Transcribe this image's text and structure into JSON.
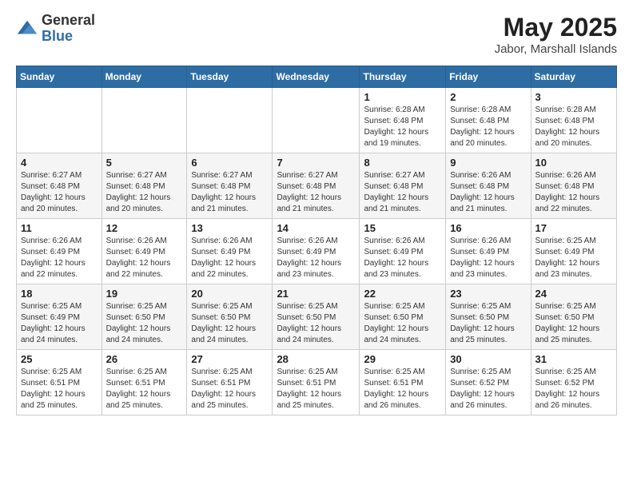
{
  "logo": {
    "general": "General",
    "blue": "Blue"
  },
  "title": "May 2025",
  "location": "Jabor, Marshall Islands",
  "days_of_week": [
    "Sunday",
    "Monday",
    "Tuesday",
    "Wednesday",
    "Thursday",
    "Friday",
    "Saturday"
  ],
  "weeks": [
    [
      {
        "day": "",
        "info": ""
      },
      {
        "day": "",
        "info": ""
      },
      {
        "day": "",
        "info": ""
      },
      {
        "day": "",
        "info": ""
      },
      {
        "day": "1",
        "info": "Sunrise: 6:28 AM\nSunset: 6:48 PM\nDaylight: 12 hours and 19 minutes."
      },
      {
        "day": "2",
        "info": "Sunrise: 6:28 AM\nSunset: 6:48 PM\nDaylight: 12 hours and 20 minutes."
      },
      {
        "day": "3",
        "info": "Sunrise: 6:28 AM\nSunset: 6:48 PM\nDaylight: 12 hours and 20 minutes."
      }
    ],
    [
      {
        "day": "4",
        "info": "Sunrise: 6:27 AM\nSunset: 6:48 PM\nDaylight: 12 hours and 20 minutes."
      },
      {
        "day": "5",
        "info": "Sunrise: 6:27 AM\nSunset: 6:48 PM\nDaylight: 12 hours and 20 minutes."
      },
      {
        "day": "6",
        "info": "Sunrise: 6:27 AM\nSunset: 6:48 PM\nDaylight: 12 hours and 21 minutes."
      },
      {
        "day": "7",
        "info": "Sunrise: 6:27 AM\nSunset: 6:48 PM\nDaylight: 12 hours and 21 minutes."
      },
      {
        "day": "8",
        "info": "Sunrise: 6:27 AM\nSunset: 6:48 PM\nDaylight: 12 hours and 21 minutes."
      },
      {
        "day": "9",
        "info": "Sunrise: 6:26 AM\nSunset: 6:48 PM\nDaylight: 12 hours and 21 minutes."
      },
      {
        "day": "10",
        "info": "Sunrise: 6:26 AM\nSunset: 6:48 PM\nDaylight: 12 hours and 22 minutes."
      }
    ],
    [
      {
        "day": "11",
        "info": "Sunrise: 6:26 AM\nSunset: 6:49 PM\nDaylight: 12 hours and 22 minutes."
      },
      {
        "day": "12",
        "info": "Sunrise: 6:26 AM\nSunset: 6:49 PM\nDaylight: 12 hours and 22 minutes."
      },
      {
        "day": "13",
        "info": "Sunrise: 6:26 AM\nSunset: 6:49 PM\nDaylight: 12 hours and 22 minutes."
      },
      {
        "day": "14",
        "info": "Sunrise: 6:26 AM\nSunset: 6:49 PM\nDaylight: 12 hours and 23 minutes."
      },
      {
        "day": "15",
        "info": "Sunrise: 6:26 AM\nSunset: 6:49 PM\nDaylight: 12 hours and 23 minutes."
      },
      {
        "day": "16",
        "info": "Sunrise: 6:26 AM\nSunset: 6:49 PM\nDaylight: 12 hours and 23 minutes."
      },
      {
        "day": "17",
        "info": "Sunrise: 6:25 AM\nSunset: 6:49 PM\nDaylight: 12 hours and 23 minutes."
      }
    ],
    [
      {
        "day": "18",
        "info": "Sunrise: 6:25 AM\nSunset: 6:49 PM\nDaylight: 12 hours and 24 minutes."
      },
      {
        "day": "19",
        "info": "Sunrise: 6:25 AM\nSunset: 6:50 PM\nDaylight: 12 hours and 24 minutes."
      },
      {
        "day": "20",
        "info": "Sunrise: 6:25 AM\nSunset: 6:50 PM\nDaylight: 12 hours and 24 minutes."
      },
      {
        "day": "21",
        "info": "Sunrise: 6:25 AM\nSunset: 6:50 PM\nDaylight: 12 hours and 24 minutes."
      },
      {
        "day": "22",
        "info": "Sunrise: 6:25 AM\nSunset: 6:50 PM\nDaylight: 12 hours and 24 minutes."
      },
      {
        "day": "23",
        "info": "Sunrise: 6:25 AM\nSunset: 6:50 PM\nDaylight: 12 hours and 25 minutes."
      },
      {
        "day": "24",
        "info": "Sunrise: 6:25 AM\nSunset: 6:50 PM\nDaylight: 12 hours and 25 minutes."
      }
    ],
    [
      {
        "day": "25",
        "info": "Sunrise: 6:25 AM\nSunset: 6:51 PM\nDaylight: 12 hours and 25 minutes."
      },
      {
        "day": "26",
        "info": "Sunrise: 6:25 AM\nSunset: 6:51 PM\nDaylight: 12 hours and 25 minutes."
      },
      {
        "day": "27",
        "info": "Sunrise: 6:25 AM\nSunset: 6:51 PM\nDaylight: 12 hours and 25 minutes."
      },
      {
        "day": "28",
        "info": "Sunrise: 6:25 AM\nSunset: 6:51 PM\nDaylight: 12 hours and 25 minutes."
      },
      {
        "day": "29",
        "info": "Sunrise: 6:25 AM\nSunset: 6:51 PM\nDaylight: 12 hours and 26 minutes."
      },
      {
        "day": "30",
        "info": "Sunrise: 6:25 AM\nSunset: 6:52 PM\nDaylight: 12 hours and 26 minutes."
      },
      {
        "day": "31",
        "info": "Sunrise: 6:25 AM\nSunset: 6:52 PM\nDaylight: 12 hours and 26 minutes."
      }
    ]
  ]
}
